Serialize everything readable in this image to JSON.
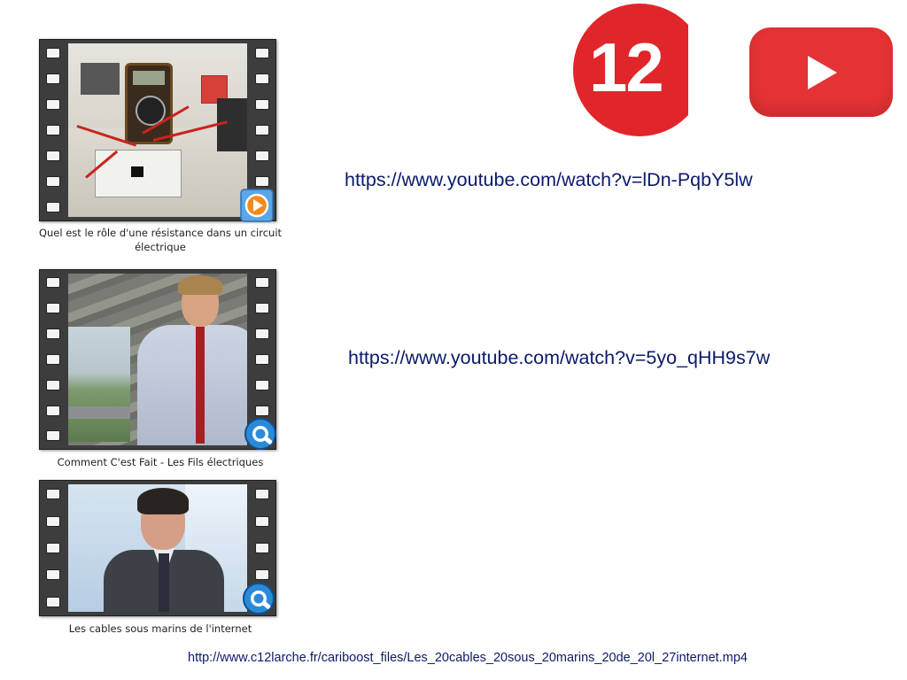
{
  "videos": [
    {
      "caption_line1": "Quel est le rôle d'une résistance dans un circuit",
      "caption_line2": "électrique",
      "link": "https://www.youtube.com/watch?v=lDn-PqbY5lw",
      "badge_icon": "media-player-icon"
    },
    {
      "caption_line1": "Comment C'est Fait - Les Fils électriques",
      "link": "https://www.youtube.com/watch?v=5yo_qHH9s7w",
      "badge_icon": "quicktime-icon"
    },
    {
      "caption_line1": "Les cables sous marins de l'internet",
      "link": "http://www.c12larche.fr/cariboost_files/Les_20cables_20sous_20marins_20de_20l_27internet.mp4",
      "badge_icon": "quicktime-icon"
    }
  ],
  "logos": {
    "channel_number": "12",
    "channel_color": "#e0262b",
    "youtube_color": "#e53234",
    "youtube_icon": "youtube-play-icon"
  },
  "colors": {
    "link": "#0b1a6a",
    "filmstrip": "#3d3d3d"
  }
}
